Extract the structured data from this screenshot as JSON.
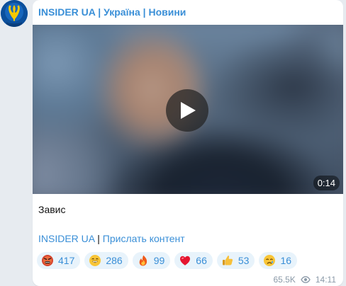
{
  "channel": {
    "title": "INSIDER UA | Україна | Новини",
    "avatar_icon": "trident-icon",
    "accent_color": "#3a8fd7"
  },
  "video": {
    "duration": "0:14",
    "play_icon": "play-icon"
  },
  "message": {
    "caption": "Завис",
    "link_primary": "INSIDER UA",
    "link_separator": " | ",
    "link_secondary": "Прислать контент"
  },
  "reactions": [
    {
      "icon": "angry-face-icon",
      "count": "417"
    },
    {
      "icon": "grinning-face-icon",
      "count": "286"
    },
    {
      "icon": "fire-icon",
      "count": "99"
    },
    {
      "icon": "heart-icon",
      "count": "66"
    },
    {
      "icon": "thumbs-up-icon",
      "count": "53"
    },
    {
      "icon": "crying-face-icon",
      "count": "16"
    }
  ],
  "footer": {
    "views": "65.5K",
    "time": "14:11",
    "views_icon": "eye-icon"
  }
}
